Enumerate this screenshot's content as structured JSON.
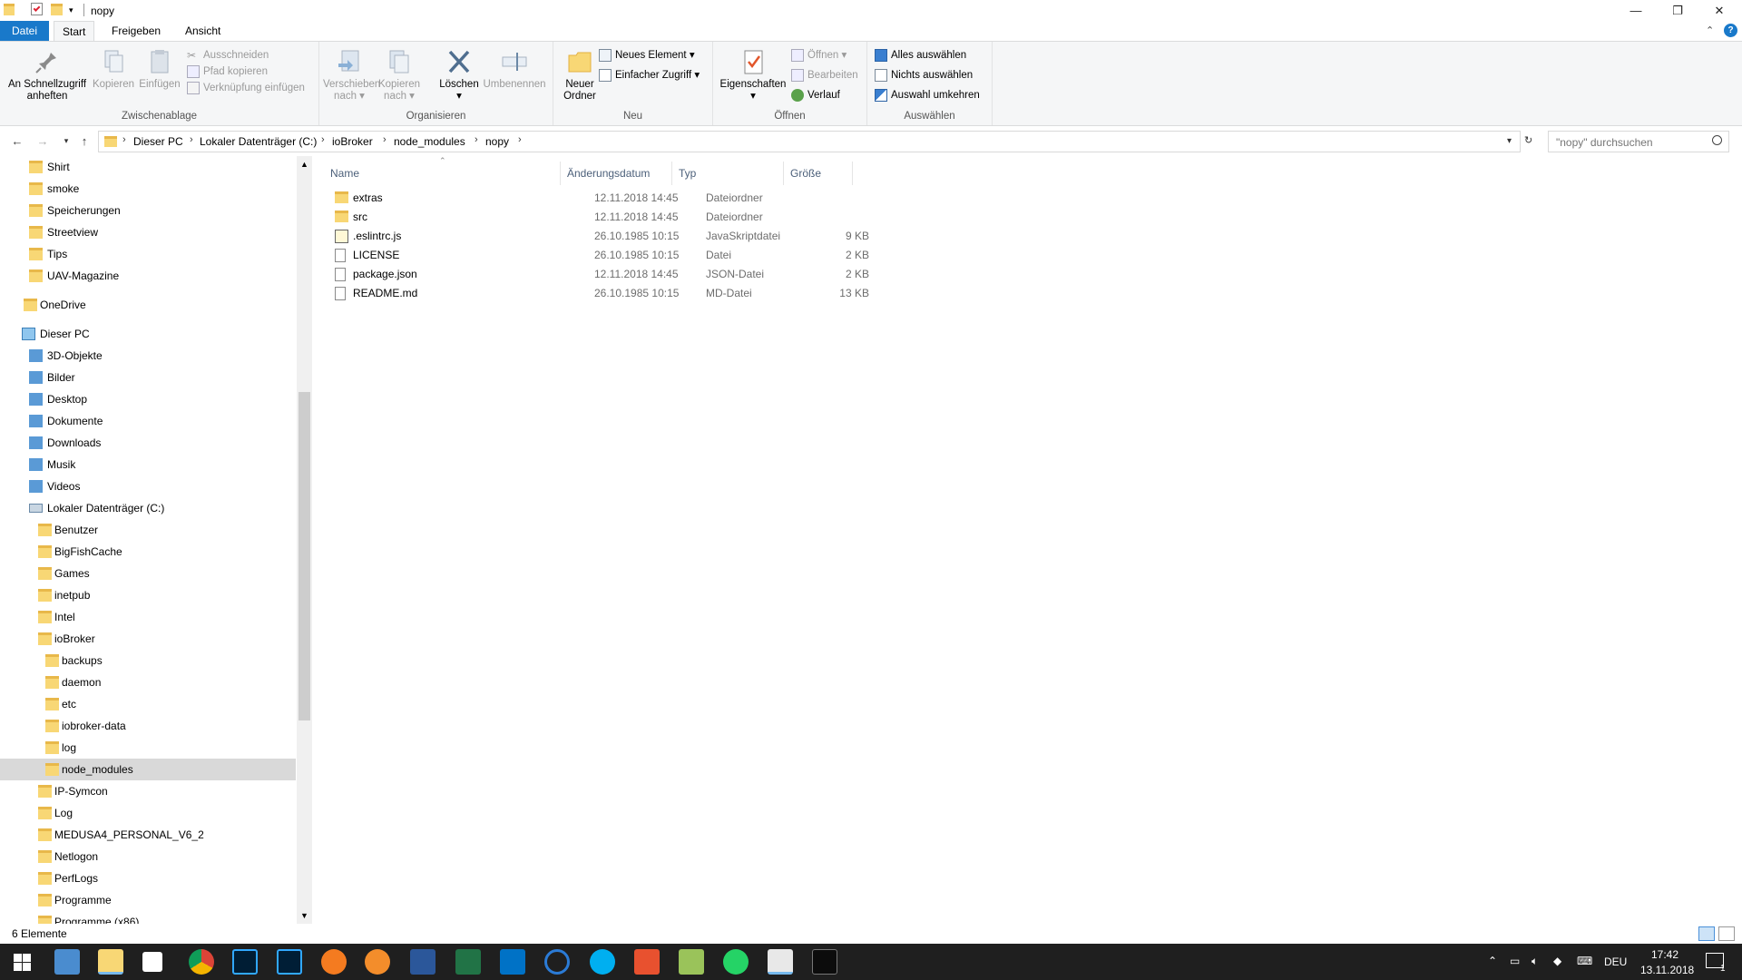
{
  "window": {
    "title": "nopy",
    "controls": {
      "minimize": "—",
      "maximize": "❐",
      "close": "✕"
    }
  },
  "tabs": [
    {
      "label": "Datei"
    },
    {
      "label": "Start"
    },
    {
      "label": "Freigeben"
    },
    {
      "label": "Ansicht"
    }
  ],
  "ribbon": {
    "groups": {
      "clipboard": "Zwischenablage",
      "organize": "Organisieren",
      "new": "Neu",
      "open": "Öffnen",
      "select": "Auswählen"
    },
    "pin": "An Schnellzugriff anheften",
    "pin_l1": "An Schnellzugriff",
    "pin_l2": "anheften",
    "copy": "Kopieren",
    "paste": "Einfügen",
    "cut": "Ausschneiden",
    "copy_path": "Pfad kopieren",
    "paste_shortcut": "Verknüpfung einfügen",
    "move_l1": "Verschieben",
    "move_l2": "nach",
    "copyto_l1": "Kopieren",
    "copyto_l2": "nach",
    "delete": "Löschen",
    "rename": "Umbenennen",
    "newfolder_l1": "Neuer",
    "newfolder_l2": "Ordner",
    "new_item": "Neues Element",
    "easy_access": "Einfacher Zugriff",
    "properties": "Eigenschaften",
    "open": "Öffnen",
    "edit": "Bearbeiten",
    "history": "Verlauf",
    "select_all": "Alles auswählen",
    "select_none": "Nichts auswählen",
    "invert": "Auswahl umkehren"
  },
  "address": {
    "crumbs": [
      "Dieser PC",
      "Lokaler Datenträger (C:)",
      "ioBroker",
      "node_modules",
      "nopy"
    ],
    "search_placeholder": "\"nopy\" durchsuchen"
  },
  "nav": {
    "quick": [
      "Shirt",
      "smoke",
      "Speicherungen",
      "Streetview",
      "Tips",
      "UAV-Magazine"
    ],
    "onedrive": "OneDrive",
    "pc": "Dieser PC",
    "pc_items": [
      "3D-Objekte",
      "Bilder",
      "Desktop",
      "Dokumente",
      "Downloads",
      "Musik",
      "Videos"
    ],
    "drive": "Lokaler Datenträger (C:)",
    "drive_items": [
      "Benutzer",
      "BigFishCache",
      "Games",
      "inetpub",
      "Intel",
      "ioBroker"
    ],
    "iobroker_items": [
      "backups",
      "daemon",
      "etc",
      "iobroker-data",
      "log",
      "node_modules"
    ],
    "drive_items2": [
      "IP-Symcon",
      "Log",
      "MEDUSA4_PERSONAL_V6_2",
      "Netlogon",
      "PerfLogs",
      "Programme",
      "Programme (x86)"
    ]
  },
  "columns": {
    "name": "Name",
    "date": "Änderungsdatum",
    "type": "Typ",
    "size": "Größe"
  },
  "files": [
    {
      "name": "extras",
      "date": "12.11.2018 14:45",
      "type": "Dateiordner",
      "size": "",
      "icon": "folder-icon"
    },
    {
      "name": "src",
      "date": "12.11.2018 14:45",
      "type": "Dateiordner",
      "size": "",
      "icon": "folder-icon"
    },
    {
      "name": ".eslintrc.js",
      "date": "26.10.1985 10:15",
      "type": "JavaSkriptdatei",
      "size": "9 KB",
      "icon": "script-file-icon"
    },
    {
      "name": "LICENSE",
      "date": "26.10.1985 10:15",
      "type": "Datei",
      "size": "2 KB",
      "icon": "file-icon"
    },
    {
      "name": "package.json",
      "date": "12.11.2018 14:45",
      "type": "JSON-Datei",
      "size": "2 KB",
      "icon": "file-icon"
    },
    {
      "name": "README.md",
      "date": "26.10.1985 10:15",
      "type": "MD-Datei",
      "size": "13 KB",
      "icon": "file-icon"
    }
  ],
  "status": {
    "count": "6 Elemente"
  },
  "tray": {
    "lang": "DEU",
    "time": "17:42",
    "date": "13.11.2018",
    "notifications": "1"
  }
}
